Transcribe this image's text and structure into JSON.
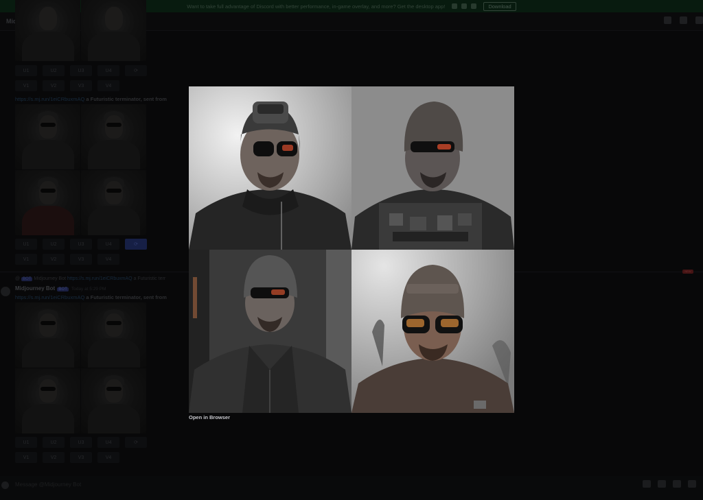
{
  "banner": {
    "text": "Want to take full advantage of Discord with better performance, in-game overlay, and more? Get the desktop app!",
    "download_label": "Download"
  },
  "channel": {
    "title": "Midjourney Bot"
  },
  "messages": [
    {
      "buttons_row1": [
        "U1",
        "U2",
        "U3",
        "U4"
      ],
      "buttons_row2": [
        "V1",
        "V2",
        "V3",
        "V4"
      ]
    },
    {
      "link_text": "https://s.mj.run/1eiCRbuxmAQ",
      "prompt": "a Futuristic terminator, sent from",
      "buttons_row1": [
        "U1",
        "U2",
        "U3",
        "U4"
      ],
      "buttons_row2": [
        "V1",
        "V2",
        "V3",
        "V4"
      ]
    },
    {
      "reply_prefix": "@",
      "reply_author": "Midjourney Bot",
      "reply_link": "https://s.mj.run/1eiCRbuxmAQ",
      "reply_prompt": "a Futuristic terr",
      "author": "Midjourney Bot",
      "bot_tag": "BOT",
      "time": "Today at 5:29 PM",
      "link_text": "https://s.mj.run/1eiCRbuxmAQ",
      "prompt": "a Futuristic terminator, sent from",
      "buttons_row1": [
        "U1",
        "U2",
        "U3",
        "U4"
      ],
      "buttons_row2": [
        "V1",
        "V2",
        "V3",
        "V4"
      ]
    }
  ],
  "new_badge": "NEW",
  "composer": {
    "placeholder": "Message @Midjourney Bot"
  },
  "modal": {
    "open_in_browser": "Open in Browser"
  },
  "colors": {
    "accent": "#23306b",
    "banner_bg": "#0d2a18"
  }
}
